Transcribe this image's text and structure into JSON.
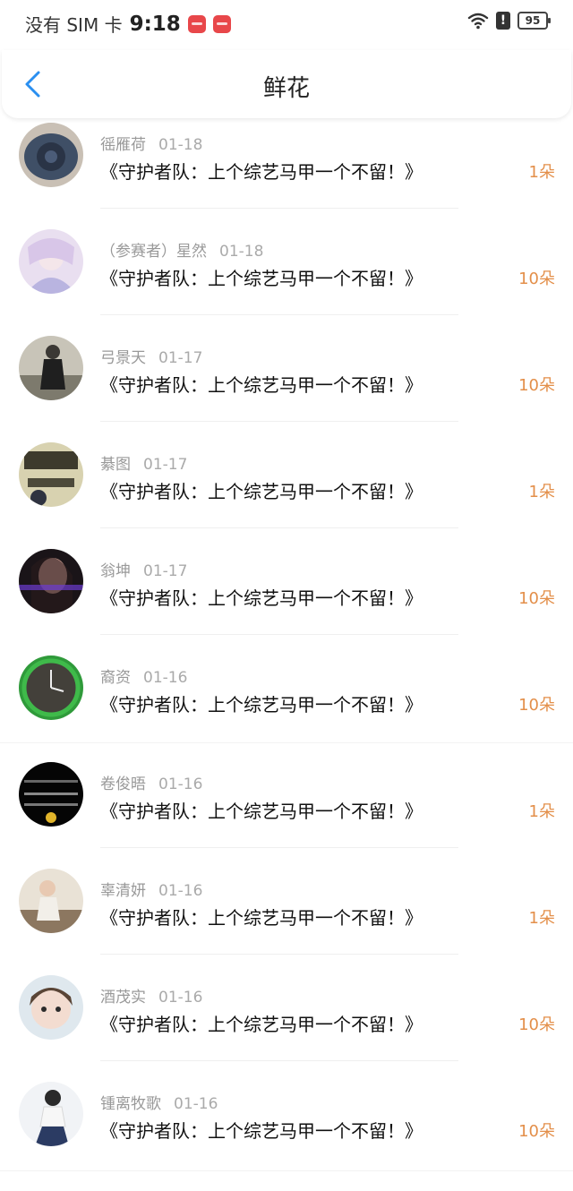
{
  "status_bar": {
    "carrier": "没有 SIM 卡",
    "time": "9:18",
    "battery": "95",
    "alert": "!"
  },
  "header": {
    "title": "鲜花",
    "back_icon": "chevron-left-icon"
  },
  "colors": {
    "accent": "#2a8ff0",
    "amount": "#e38f4a",
    "meta": "#999999"
  },
  "items": [
    {
      "name": "徭雁荷",
      "date": "01-18",
      "message": "《守护者队：上个综艺马甲一个不留！》",
      "amount": "1朵"
    },
    {
      "name": "（参赛者）星然",
      "date": "01-18",
      "message": "《守护者队：上个综艺马甲一个不留！》",
      "amount": "10朵"
    },
    {
      "name": "弓景天",
      "date": "01-17",
      "message": "《守护者队：上个综艺马甲一个不留！》",
      "amount": "10朵"
    },
    {
      "name": "綦图",
      "date": "01-17",
      "message": "《守护者队：上个综艺马甲一个不留！》",
      "amount": "1朵"
    },
    {
      "name": "翁坤",
      "date": "01-17",
      "message": "《守护者队：上个综艺马甲一个不留！》",
      "amount": "10朵"
    },
    {
      "name": "裔资",
      "date": "01-16",
      "message": "《守护者队：上个综艺马甲一个不留！》",
      "amount": "10朵"
    },
    {
      "name": "卷俊晤",
      "date": "01-16",
      "message": "《守护者队：上个综艺马甲一个不留！》",
      "amount": "1朵"
    },
    {
      "name": "辜清妍",
      "date": "01-16",
      "message": "《守护者队：上个综艺马甲一个不留！》",
      "amount": "1朵"
    },
    {
      "name": "酒茂实",
      "date": "01-16",
      "message": "《守护者队：上个综艺马甲一个不留！》",
      "amount": "10朵"
    },
    {
      "name": "锺离牧歌",
      "date": "01-16",
      "message": "《守护者队：上个综艺马甲一个不留！》",
      "amount": "10朵"
    }
  ]
}
